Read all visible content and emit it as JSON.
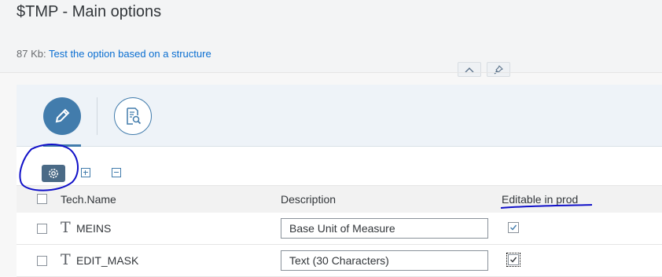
{
  "header": {
    "title": "$TMP - Main options",
    "size": "87 Kb:",
    "description_link": "Test the option based on a structure",
    "collapse_icon": "chevron-up-icon",
    "pin_icon": "pin-icon"
  },
  "icontabs": [
    {
      "name": "edit",
      "icon": "pencil-icon",
      "selected": true
    },
    {
      "name": "review",
      "icon": "document-search-icon",
      "selected": false
    }
  ],
  "toolbar": {
    "settings_icon": "gear-icon",
    "expand_icon": "expand-all-icon",
    "collapse_icon": "collapse-all-icon"
  },
  "table": {
    "columns": [
      "Tech.Name",
      "Description",
      "Editable in prod"
    ],
    "rows": [
      {
        "type_icon": "T",
        "name": "MEINS",
        "description": "Base Unit of Measure",
        "editable": true
      },
      {
        "type_icon": "T",
        "name": "EDIT_MASK",
        "description": "Text (30 Characters)",
        "editable": true
      }
    ]
  },
  "colors": {
    "accent": "#427cac",
    "link": "#0a6ed1",
    "annotation": "#1010c8"
  }
}
